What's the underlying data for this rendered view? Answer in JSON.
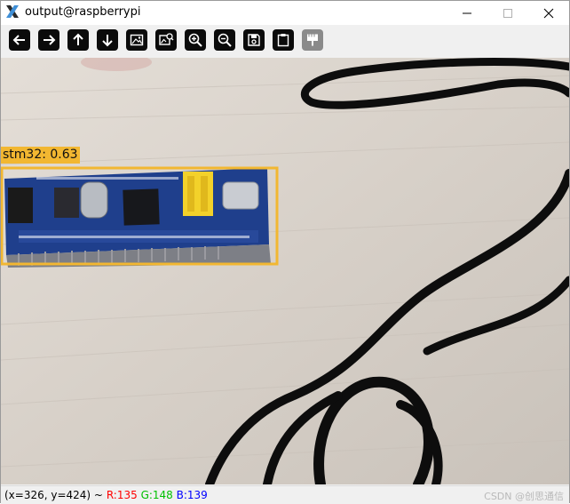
{
  "window": {
    "title": "output@raspberrypi",
    "controls": {
      "minimize": "minimize-icon",
      "maximize": "maximize-icon",
      "close": "close-icon"
    }
  },
  "toolbar": {
    "buttons": [
      {
        "name": "pan-left-button",
        "icon": "arrow-left-icon",
        "enabled": true
      },
      {
        "name": "pan-right-button",
        "icon": "arrow-right-icon",
        "enabled": true
      },
      {
        "name": "pan-up-button",
        "icon": "arrow-up-icon",
        "enabled": true
      },
      {
        "name": "pan-down-button",
        "icon": "arrow-down-icon",
        "enabled": true
      },
      {
        "name": "zoom-fit-button",
        "icon": "image-icon",
        "enabled": true
      },
      {
        "name": "zoom-original-button",
        "icon": "image-zoom-icon",
        "enabled": true
      },
      {
        "name": "zoom-in-button",
        "icon": "zoom-in-icon",
        "enabled": true
      },
      {
        "name": "zoom-out-button",
        "icon": "zoom-out-icon",
        "enabled": true
      },
      {
        "name": "save-button",
        "icon": "save-icon",
        "enabled": true
      },
      {
        "name": "copy-button",
        "icon": "clipboard-icon",
        "enabled": true
      },
      {
        "name": "properties-button",
        "icon": "paintbrush-icon",
        "enabled": false
      }
    ]
  },
  "detection": {
    "label": "stm32: 0.63",
    "box_color": "#f2b731"
  },
  "statusbar": {
    "position": "(x=326, y=424) ~",
    "r": "R:135",
    "g": "G:148",
    "b": "B:139",
    "r_color": "#ff0000",
    "g_color": "#00c000",
    "b_color": "#0000ff",
    "watermark": "CSDN @创思通信"
  }
}
